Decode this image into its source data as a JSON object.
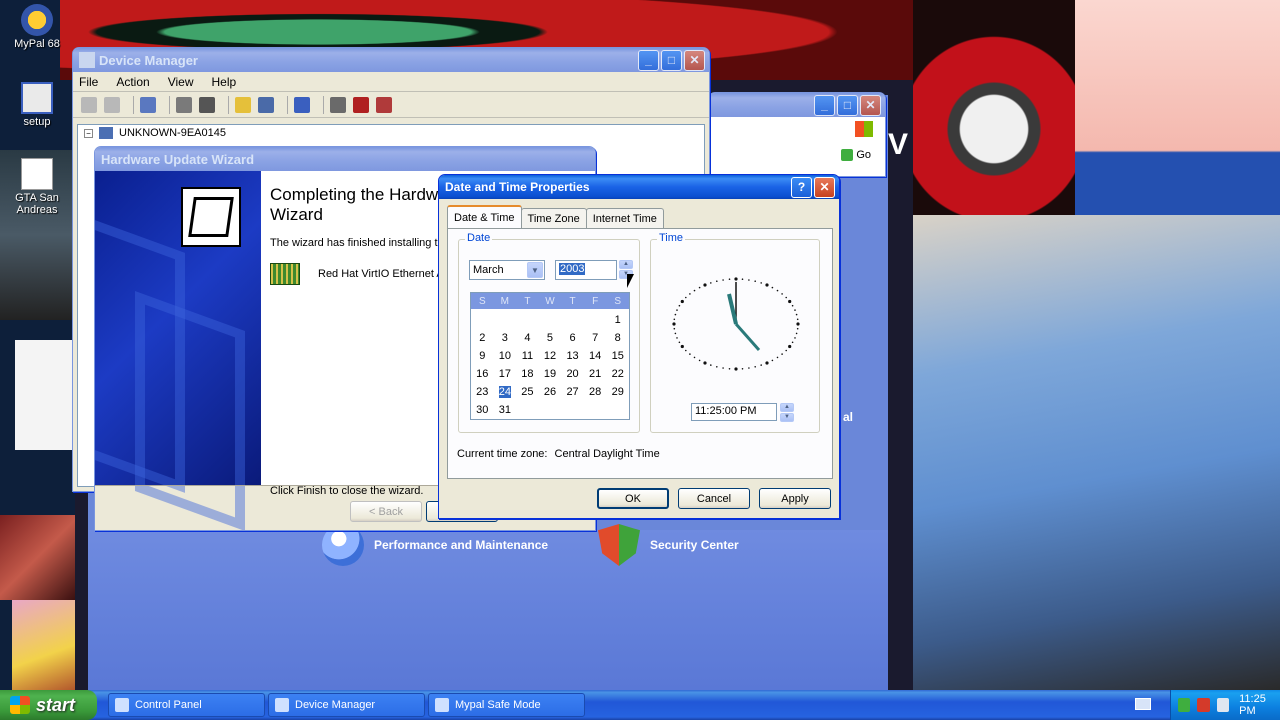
{
  "desktop": {
    "icons": [
      {
        "label": "MyPal 68"
      },
      {
        "label": "setup"
      },
      {
        "label": "GTA San Andreas"
      }
    ]
  },
  "devmgr": {
    "title": "Device Manager",
    "menu": [
      "File",
      "Action",
      "View",
      "Help"
    ],
    "tree_root": "UNKNOWN-9EA0145"
  },
  "cpanel": {
    "go_label": "Go",
    "partial_letter": "V",
    "partial_text": "al",
    "categories": [
      {
        "label": "Performance and Maintenance"
      },
      {
        "label": "Security Center"
      }
    ]
  },
  "wizard": {
    "title": "Hardware Update Wizard",
    "heading": "Completing the Hardw  Wizard",
    "heading_line1": "Completing the Hardw",
    "heading_line2": "Wizard",
    "text": "The wizard has finished installing the",
    "device": "Red Hat VirtIO Ethernet A",
    "finish_text": "Click Finish to close the wizard.",
    "back_label": "< Back"
  },
  "datetime": {
    "title": "Date and Time Properties",
    "help_label": "?",
    "tabs": [
      "Date & Time",
      "Time Zone",
      "Internet Time"
    ],
    "date_group": "Date",
    "time_group": "Time",
    "month": "March",
    "year": "2003",
    "weekdays": [
      "S",
      "M",
      "T",
      "W",
      "T",
      "F",
      "S"
    ],
    "days": [
      "",
      "",
      "",
      "",
      "",
      "",
      "1",
      "2",
      "3",
      "4",
      "5",
      "6",
      "7",
      "8",
      "9",
      "10",
      "11",
      "12",
      "13",
      "14",
      "15",
      "16",
      "17",
      "18",
      "19",
      "20",
      "21",
      "22",
      "23",
      "24",
      "25",
      "26",
      "27",
      "28",
      "29",
      "30",
      "31",
      "",
      "",
      "",
      "",
      ""
    ],
    "selected_day": "24",
    "time": "11:25:00 PM",
    "tz_label": "Current time zone:",
    "tz_value": "Central Daylight Time",
    "ok_label": "OK",
    "cancel_label": "Cancel",
    "apply_label": "Apply"
  },
  "taskbar": {
    "start_label": "start",
    "tasks": [
      {
        "label": "Control Panel"
      },
      {
        "label": "Device Manager"
      },
      {
        "label": "Mypal Safe Mode"
      }
    ],
    "clock": "11:25 PM"
  }
}
